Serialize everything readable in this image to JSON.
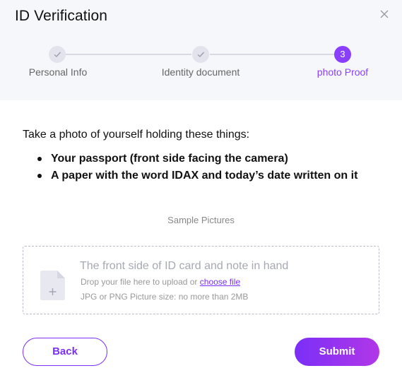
{
  "dialog": {
    "title": "ID Verification",
    "close_icon": "close-icon"
  },
  "stepper": {
    "steps": [
      {
        "label": "Personal Info",
        "state": "done",
        "icon": "check-icon"
      },
      {
        "label": "Identity document",
        "state": "done",
        "icon": "check-icon"
      },
      {
        "label": "photo Proof",
        "state": "active",
        "number": "3"
      }
    ],
    "accent_color": "#8a3ffc"
  },
  "content": {
    "instruction": "Take a photo of yourself holding these things:",
    "bullets": [
      "Your passport (front side facing the camera)",
      "A paper with the word IDAX and today’s date written on it"
    ],
    "sample_label": "Sample Pictures"
  },
  "upload": {
    "icon": "file-add-icon",
    "title": "The front side of ID card and note in hand",
    "hint_prefix": "Drop your file here to upload or ",
    "choose_file": "choose file",
    "requirements": "JPG or PNG Picture size: no more than 2MB"
  },
  "actions": {
    "back_label": "Back",
    "submit_label": "Submit"
  }
}
